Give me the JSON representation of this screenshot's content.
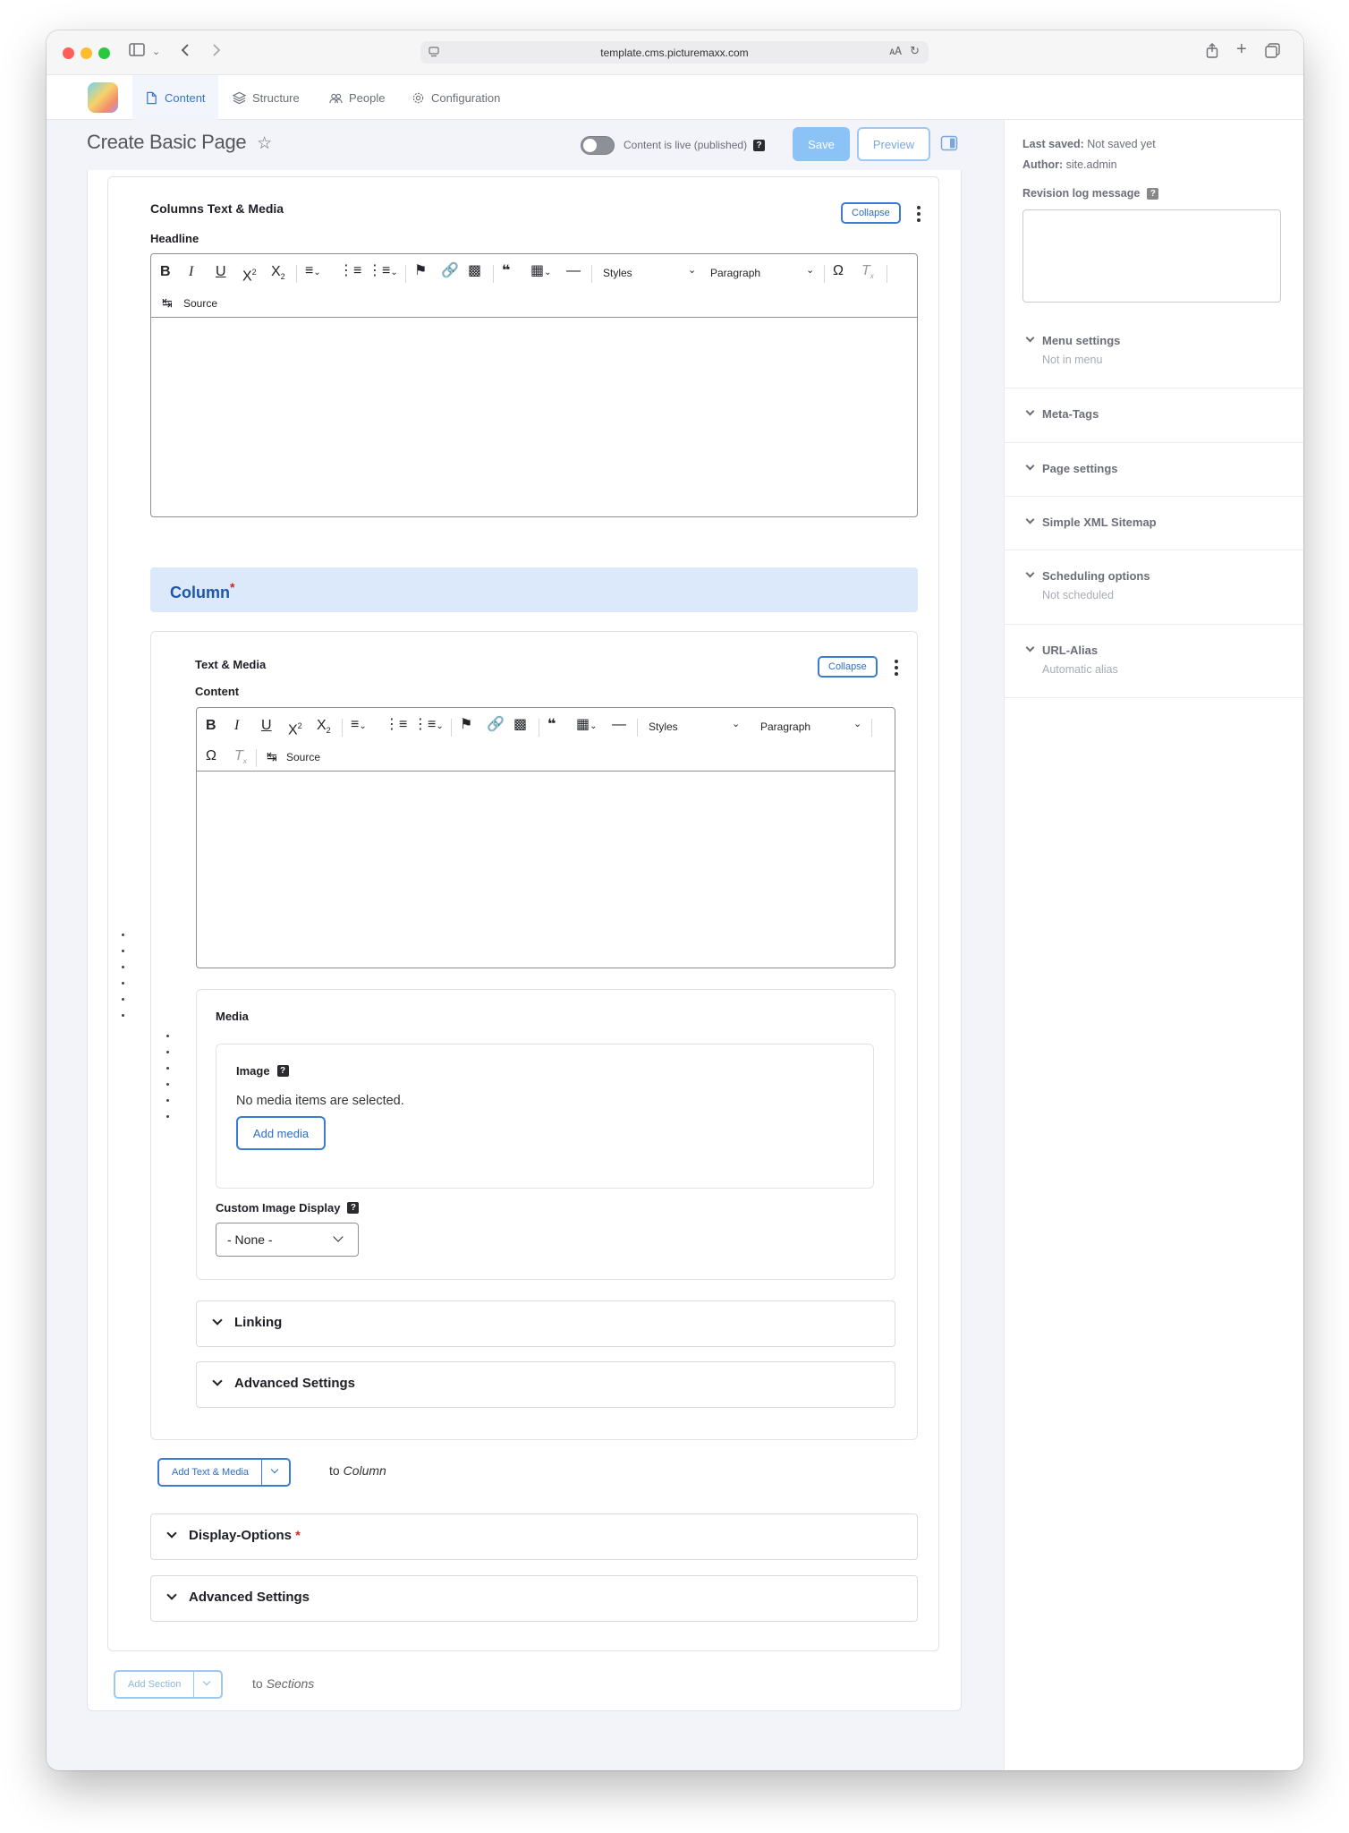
{
  "browser": {
    "url": "template.cms.picturemaxx.com"
  },
  "nav": {
    "items": [
      {
        "label": "Content",
        "icon": "document-icon",
        "active": true
      },
      {
        "label": "Structure",
        "icon": "layers-icon",
        "active": false
      },
      {
        "label": "People",
        "icon": "people-icon",
        "active": false
      },
      {
        "label": "Configuration",
        "icon": "gear-icon",
        "active": false
      }
    ]
  },
  "header": {
    "title": "Create Basic Page",
    "live_label": "Content is live (published)",
    "help": "?",
    "save_label": "Save",
    "preview_label": "Preview"
  },
  "section": {
    "title": "Columns Text & Media",
    "collapse_label": "Collapse",
    "headline_label": "Headline",
    "column_label": "Column",
    "required_mark": "*",
    "add_text_media_label": "Add Text & Media",
    "to_label": "to",
    "to_target": "Column",
    "display_options_label": "Display-Options",
    "advanced_settings_label": "Advanced Settings"
  },
  "editor": {
    "styles_label": "Styles",
    "paragraph_label": "Paragraph",
    "source_label": "Source"
  },
  "text_media": {
    "title": "Text & Media",
    "collapse_label": "Collapse",
    "content_label": "Content",
    "media_label": "Media",
    "image_label": "Image",
    "no_media_text": "No media items are selected.",
    "add_media_label": "Add media",
    "custom_display_label": "Custom Image Display",
    "custom_display_value": "- None -",
    "linking_label": "Linking",
    "advanced_settings_label": "Advanced Settings"
  },
  "footer": {
    "add_section_label": "Add Section",
    "to_label": "to",
    "to_target": "Sections"
  },
  "sidebar": {
    "last_saved_key": "Last saved:",
    "last_saved_value": "Not saved yet",
    "author_key": "Author:",
    "author_value": "site.admin",
    "revision_label": "Revision log message",
    "items": [
      {
        "title": "Menu settings",
        "subtitle": "Not in menu"
      },
      {
        "title": "Meta-Tags",
        "subtitle": ""
      },
      {
        "title": "Page settings",
        "subtitle": ""
      },
      {
        "title": "Simple XML Sitemap",
        "subtitle": ""
      },
      {
        "title": "Scheduling options",
        "subtitle": "Not scheduled"
      },
      {
        "title": "URL-Alias",
        "subtitle": "Automatic alias"
      }
    ]
  },
  "colors": {
    "accent": "#3374d6",
    "save_bg": "#8cc3f7",
    "column_bar_bg": "#dbe9fb",
    "required": "#d72222"
  }
}
